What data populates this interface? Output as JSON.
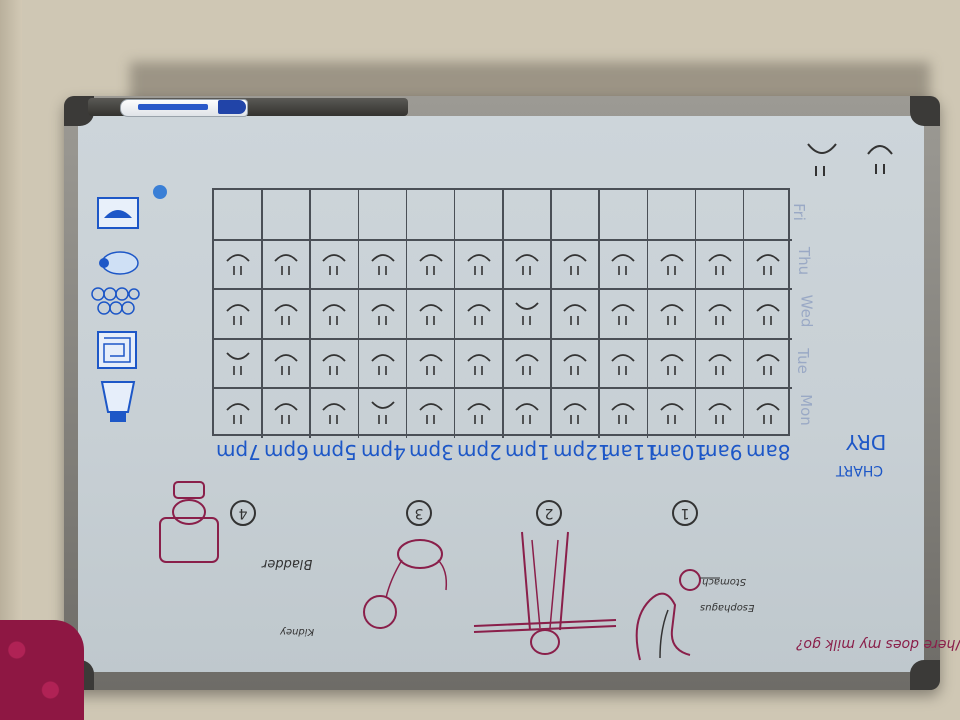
{
  "board": {
    "title_line1": "DRY",
    "title_line2": "CHART",
    "question": "Where does my milk go?",
    "legend_face_label": "=",
    "hours": [
      "8am",
      "9am",
      "10am",
      "11am",
      "12pm",
      "1pm",
      "2pm",
      "3pm",
      "4pm",
      "5pm",
      "6pm",
      "7pm"
    ],
    "days": [
      "Mon",
      "Tue",
      "Wed",
      "Thu",
      "Fri"
    ],
    "steps": [
      "1",
      "2",
      "3",
      "4"
    ],
    "labels": {
      "stomach": "Stomach",
      "esophagus": "Esophagus",
      "kidney": "Kidney",
      "bladder": "Bladder"
    },
    "rows_filled": [
      {
        "day": "Mon",
        "faces": [
          "smile",
          "smile",
          "smile",
          "smile",
          "smile",
          "smile",
          "smile",
          "smile",
          "frown",
          "smile",
          "smile",
          "smile"
        ]
      },
      {
        "day": "Tue",
        "faces": [
          "smile",
          "smile",
          "smile",
          "smile",
          "smile",
          "smile",
          "smile",
          "smile",
          "smile",
          "smile",
          "smile",
          "frown"
        ]
      },
      {
        "day": "Wed",
        "faces": [
          "smile",
          "smile",
          "smile",
          "smile",
          "smile",
          "frown",
          "smile",
          "smile",
          "smile",
          "smile",
          "smile",
          "smile"
        ]
      },
      {
        "day": "Thu",
        "faces": [
          "smile",
          "smile",
          "smile",
          "smile",
          "smile",
          "smile",
          "smile",
          "smile",
          "smile",
          "smile",
          "smile",
          "smile"
        ]
      },
      {
        "day": "Fri",
        "faces": []
      }
    ],
    "colors": {
      "blue_ink": "#1d57c7",
      "red_ink": "#8a1f4a",
      "black_ink": "#333333",
      "marker_blue": "#2144a8"
    }
  }
}
